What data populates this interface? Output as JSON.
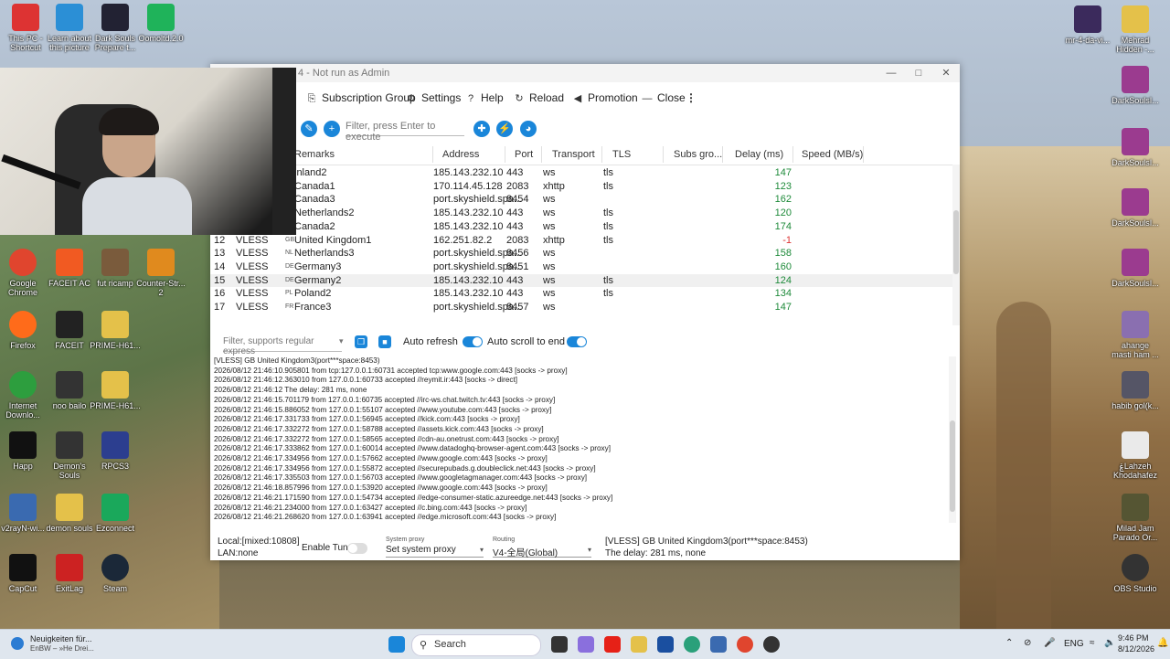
{
  "desktop": {
    "icons_left": [
      {
        "label": "This PC -\nShortcut",
        "color": "#d33"
      },
      {
        "label": "Learn about\nthis picture",
        "color": "#2b8fd6"
      },
      {
        "label": "Dark Souls\nPrepare t...",
        "color": "#223"
      },
      {
        "label": "Oomoltd.2.0",
        "color": "#1fb35a"
      }
    ],
    "icons_mid": [
      {
        "label": "Google\nChrome",
        "color": "#e0452e"
      },
      {
        "label": "FACEIT AC",
        "color": "#f15a22"
      },
      {
        "label": "fut ricamp",
        "color": "#7a5b3c"
      },
      {
        "label": "Counter-Str...\n2",
        "color": "#e08a1e"
      },
      {
        "label": "Firefox",
        "color": "#ff6b1a"
      },
      {
        "label": "FACEIT",
        "color": "#222"
      },
      {
        "label": "PRIME-H61...",
        "color": "#e4c14a"
      },
      {
        "label": "Internet\nDownlo...",
        "color": "#2d9e3e"
      },
      {
        "label": "noo bailo",
        "color": "#333"
      },
      {
        "label": "PRIME-H61...",
        "color": "#e4c14a"
      },
      {
        "label": "Happ",
        "color": "#111"
      },
      {
        "label": "Demon's\nSouls",
        "color": "#333"
      },
      {
        "label": "RPCS3",
        "color": "#2c3e8f"
      },
      {
        "label": "v2rayN-wi...",
        "color": "#3a6ab0"
      },
      {
        "label": "demon souls",
        "color": "#e4c14a"
      },
      {
        "label": "Ezconnect",
        "color": "#1aa85b"
      },
      {
        "label": "CapCut",
        "color": "#111"
      },
      {
        "label": "ExitLag",
        "color": "#c22"
      },
      {
        "label": "Steam",
        "color": "#1b2838"
      }
    ],
    "icons_right": [
      {
        "label": "mr-4-da-vi...",
        "color": "#3b2a5c"
      },
      {
        "label": "Mehrad\nHidden -...",
        "color": "#e4c14a"
      },
      {
        "label": "DarkSoulsI...",
        "color": "#9b3b8f"
      },
      {
        "label": "DarkSoulsI...",
        "color": "#9b3b8f"
      },
      {
        "label": "DarkSoulsI...",
        "color": "#9b3b8f"
      },
      {
        "label": "DarkSoulsI...",
        "color": "#9b3b8f"
      },
      {
        "label": "ahange\nmasti ham ...",
        "color": "#8a6fb0"
      },
      {
        "label": "habib gol(k...",
        "color": "#556"
      },
      {
        "label": "ۼLahzeh\nKhodahafez",
        "color": "#eaeaea"
      },
      {
        "label": "Milad Jam\nParado Or...",
        "color": "#553"
      },
      {
        "label": "OBS Studio",
        "color": "#333"
      }
    ]
  },
  "window": {
    "title": "4 - Not run as Admin",
    "toolbar": [
      {
        "icon": "⎘",
        "label": "Subscription Group"
      },
      {
        "icon": "⚙",
        "label": "Settings"
      },
      {
        "icon": "?",
        "label": "Help"
      },
      {
        "icon": "↻",
        "label": "Reload"
      },
      {
        "icon": "◀",
        "label": "Promotion"
      },
      {
        "icon": "—",
        "label": "Close"
      }
    ],
    "more_icon": "⋮",
    "filter_placeholder": "Filter, press Enter to execute",
    "columns": [
      "Remarks",
      "Address",
      "Port",
      "Transport",
      "TLS",
      "Subs gro...",
      "Delay (ms)",
      "Speed (MB/s)"
    ],
    "rows": [
      {
        "num": "",
        "type": "",
        "flag": "",
        "remarks": "inland2",
        "address": "185.143.232.10",
        "port": "443",
        "transport": "ws",
        "tls": "tls",
        "delay": "147"
      },
      {
        "num": "",
        "type": "",
        "flag": "",
        "remarks": "Canada1",
        "address": "170.114.45.128",
        "port": "2083",
        "transport": "xhttp",
        "tls": "tls",
        "delay": "123"
      },
      {
        "num": "",
        "type": "",
        "flag": "",
        "remarks": "Canada3",
        "address": "port.skyshield.spa...",
        "port": "8454",
        "transport": "ws",
        "tls": "",
        "delay": "162"
      },
      {
        "num": "",
        "type": "",
        "flag": "",
        "remarks": "Netherlands2",
        "address": "185.143.232.10",
        "port": "443",
        "transport": "ws",
        "tls": "tls",
        "delay": "120"
      },
      {
        "num": "",
        "type": "",
        "flag": "",
        "remarks": "Canada2",
        "address": "185.143.232.10",
        "port": "443",
        "transport": "ws",
        "tls": "tls",
        "delay": "174"
      },
      {
        "num": "12",
        "type": "VLESS",
        "flag": "GB",
        "remarks": "United Kingdom1",
        "address": "162.251.82.2",
        "port": "2083",
        "transport": "xhttp",
        "tls": "tls",
        "delay": "-1"
      },
      {
        "num": "13",
        "type": "VLESS",
        "flag": "NL",
        "remarks": "Netherlands3",
        "address": "port.skyshield.spa...",
        "port": "8456",
        "transport": "ws",
        "tls": "",
        "delay": "158"
      },
      {
        "num": "14",
        "type": "VLESS",
        "flag": "DE",
        "remarks": "Germany3",
        "address": "port.skyshield.spa...",
        "port": "8451",
        "transport": "ws",
        "tls": "",
        "delay": "160"
      },
      {
        "num": "15",
        "type": "VLESS",
        "flag": "DE",
        "remarks": "Germany2",
        "address": "185.143.232.10",
        "port": "443",
        "transport": "ws",
        "tls": "tls",
        "delay": "124"
      },
      {
        "num": "16",
        "type": "VLESS",
        "flag": "PL",
        "remarks": "Poland2",
        "address": "185.143.232.10",
        "port": "443",
        "transport": "ws",
        "tls": "tls",
        "delay": "134"
      },
      {
        "num": "17",
        "type": "VLESS",
        "flag": "FR",
        "remarks": "France3",
        "address": "port.skyshield.spa...",
        "port": "8457",
        "transport": "ws",
        "tls": "",
        "delay": "147"
      }
    ],
    "log_filter_placeholder": "Filter, supports regular express",
    "auto_refresh_label": "Auto refresh",
    "auto_scroll_label": "Auto scroll to end",
    "log_lines": [
      "[VLESS] GB United Kingdom3(port***space:8453)",
      "2026/08/12 21:46:10.905801 from tcp:127.0.0.1:60731 accepted tcp:www.google.com:443 [socks -> proxy]",
      "2026/08/12 21:46:12.363010 from 127.0.0.1:60733 accepted //reymit.ir:443 [socks -> direct]",
      "2026/08/12 21:46:12 The delay: 281 ms, none",
      "2026/08/12 21:46:15.701179 from 127.0.0.1:60735 accepted //irc-ws.chat.twitch.tv:443 [socks -> proxy]",
      "2026/08/12 21:46:15.886052 from 127.0.0.1:55107 accepted //www.youtube.com:443 [socks -> proxy]",
      "2026/08/12 21:46:17.331733 from 127.0.0.1:56945 accepted //kick.com:443 [socks -> proxy]",
      "2026/08/12 21:46:17.332272 from 127.0.0.1:58788 accepted //assets.kick.com:443 [socks -> proxy]",
      "2026/08/12 21:46:17.332272 from 127.0.0.1:58565 accepted //cdn-au.onetrust.com:443 [socks -> proxy]",
      "2026/08/12 21:46:17.333862 from 127.0.0.1:60014 accepted //www.datadoghq-browser-agent.com:443 [socks -> proxy]",
      "2026/08/12 21:46:17.334956 from 127.0.0.1:57662 accepted //www.google.com:443 [socks -> proxy]",
      "2026/08/12 21:46:17.334956 from 127.0.0.1:55872 accepted //securepubads.g.doubleclick.net:443 [socks -> proxy]",
      "2026/08/12 21:46:17.335503 from 127.0.0.1:56703 accepted //www.googletagmanager.com:443 [socks -> proxy]",
      "2026/08/12 21:46:18.857996 from 127.0.0.1:53920 accepted //www.google.com:443 [socks -> proxy]",
      "2026/08/12 21:46:21.171590 from 127.0.0.1:54734 accepted //edge-consumer-static.azureedge.net:443 [socks -> proxy]",
      "2026/08/12 21:46:21.234000 from 127.0.0.1:63427 accepted //c.bing.com:443 [socks -> proxy]",
      "2026/08/12 21:46:21.268620 from 127.0.0.1:63941 accepted //edge.microsoft.com:443 [socks -> proxy]"
    ],
    "status": {
      "local": "Local:[mixed:10808]",
      "lan": "LAN:none",
      "enable_tun": "Enable Tun",
      "system_proxy_caption": "System proxy",
      "system_proxy_value": "Set system proxy",
      "routing_caption": "Routing",
      "routing_value": "V4-全局(Global)",
      "server": "[VLESS] GB United Kingdom3(port***space:8453)",
      "delay": "The delay: 281 ms, none"
    }
  },
  "taskbar": {
    "news_title": "Neuigkeiten für...",
    "news_sub": "EnBW – »He Drei...",
    "search_label": "Search",
    "lang": "ENG",
    "time": "9:46 PM",
    "date": "8/12/2026"
  },
  "colors": {
    "accent": "#1a86d9",
    "delay_good": "#1e8a3a",
    "delay_bad": "#d33"
  }
}
